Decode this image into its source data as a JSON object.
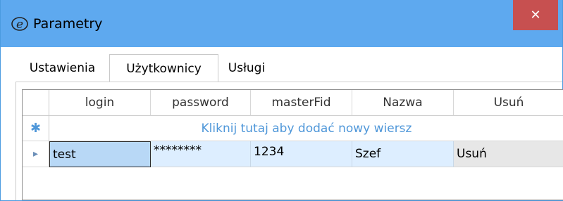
{
  "window": {
    "title": "Parametry",
    "close_label": "✕"
  },
  "tabs": [
    {
      "label": "Ustawienia"
    },
    {
      "label": "Użytkownicy"
    },
    {
      "label": "Usługi"
    }
  ],
  "grid": {
    "columns": [
      "login",
      "password",
      "masterFid",
      "Nazwa",
      "Usuń"
    ],
    "new_row_marker": "✱",
    "new_row_text": "Kliknij tutaj aby dodać nowy wiersz",
    "current_row_marker": "▸",
    "rows": [
      {
        "login": "test",
        "password": "********",
        "masterFid": "1234",
        "Nazwa": "Szef",
        "Usun": "Usuń"
      }
    ]
  },
  "colors": {
    "titlebar": "#5ea9ef",
    "close": "#c75050",
    "selection": "#ddeeff",
    "link": "#4f97d9"
  }
}
